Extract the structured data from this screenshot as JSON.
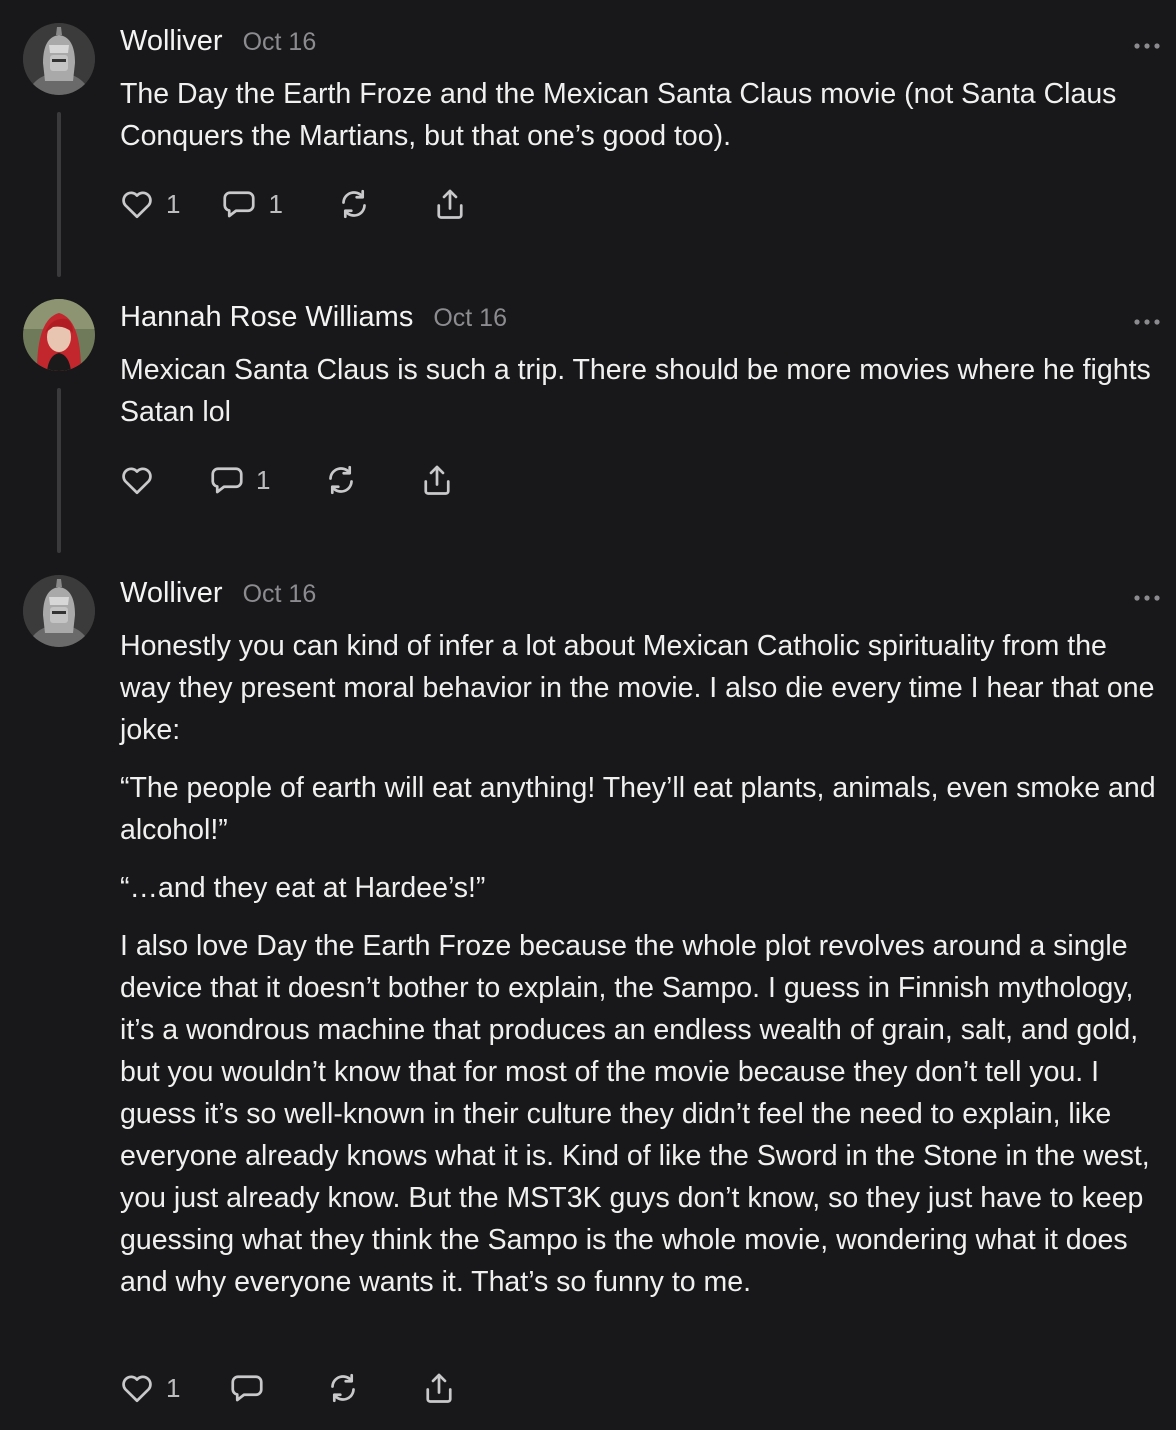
{
  "comments": [
    {
      "author": "Wolliver",
      "date": "Oct 16",
      "paragraphs": [
        "The Day the Earth Froze and the Mexican Santa Claus movie (not Santa Claus Conquers the Martians, but that one’s good too)."
      ],
      "likes": "1",
      "replies": "1",
      "avatar_icon": "knight-helmet-avatar"
    },
    {
      "author": "Hannah Rose Williams",
      "date": "Oct 16",
      "paragraphs": [
        "Mexican Santa Claus is such a trip. There should be more movies where he fights Satan lol"
      ],
      "likes": "",
      "replies": "1",
      "avatar_icon": "red-hair-portrait-avatar"
    },
    {
      "author": "Wolliver",
      "date": "Oct 16",
      "paragraphs": [
        "Honestly you can kind of infer a lot about Mexican Catholic spirituality from the way they present moral behavior in the movie. I also die every time I hear that one joke:",
        "“The people of earth will eat anything! They’ll eat plants, animals, even smoke and alcohol!”",
        "“…and they eat at Hardee’s!”",
        "I also love Day the Earth Froze because the whole plot revolves around a single device that it doesn’t bother to explain, the Sampo. I guess in Finnish mythology, it’s a wondrous machine that produces an endless wealth of grain, salt, and gold, but you wouldn’t know that for most of the movie because they don’t tell you. I guess it’s so well-known in their culture they didn’t feel the need to explain, like everyone already knows what it is. Kind of like the Sword in the Stone in the west, you just already know. But the MST3K guys don’t know, so they just have to keep guessing what they think the Sampo is the whole movie, wondering what it does and why everyone wants it. That’s so funny to me."
      ],
      "likes": "1",
      "replies": "",
      "avatar_icon": "knight-helmet-avatar"
    }
  ],
  "icons": {
    "like": "heart-icon",
    "reply": "speech-bubble-icon",
    "restack": "restack-icon",
    "share": "share-icon",
    "more": "more-dots-icon"
  },
  "colors": {
    "background": "#18181a",
    "text": "#f0f0f0",
    "muted": "#8c8c90",
    "icon": "#c9c9cc",
    "thread_line": "#3a3a3c"
  }
}
